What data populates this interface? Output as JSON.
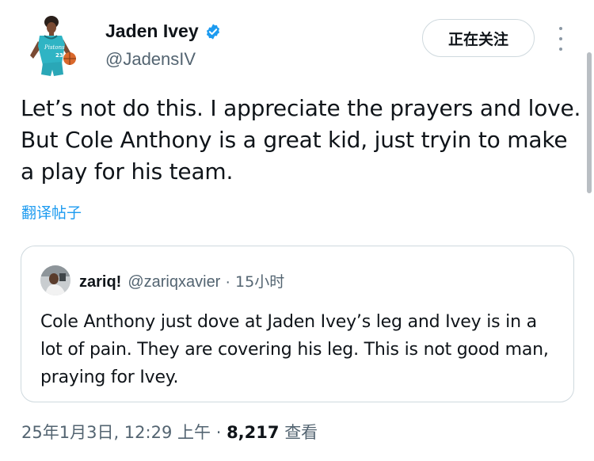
{
  "author": {
    "name": "Jaden Ivey",
    "handle": "@JadensIV",
    "verified_icon": "verified-badge-icon",
    "jersey_text": "Pistons",
    "jersey_number": "23"
  },
  "follow_button": {
    "label": "正在关注"
  },
  "more_menu": {
    "icon": "more-vertical-icon"
  },
  "tweet": {
    "text": "Let’s not do this. I appreciate the prayers and love. But Cole Anthony is a great kid, just tryin to make a play for his team.",
    "translate_label": "翻译帖子"
  },
  "quoted": {
    "name": "zariq!",
    "handle": "@zariqxavier",
    "separator": "·",
    "time": "15小时",
    "text": "Cole Anthony just dove at Jaden Ivey’s leg and Ivey is in a lot of pain. They are covering his leg. This is not good man, praying for Ivey."
  },
  "meta": {
    "timestamp": "25年1月3日, 12:29 上午",
    "separator": "·",
    "views_count": "8,217",
    "views_label": "查看"
  },
  "colors": {
    "text_primary": "#0f1419",
    "text_secondary": "#536471",
    "link": "#1d9bf0",
    "verified": "#1d9bf0",
    "border": "#cfd9de",
    "jersey": "#2fb4c4"
  }
}
